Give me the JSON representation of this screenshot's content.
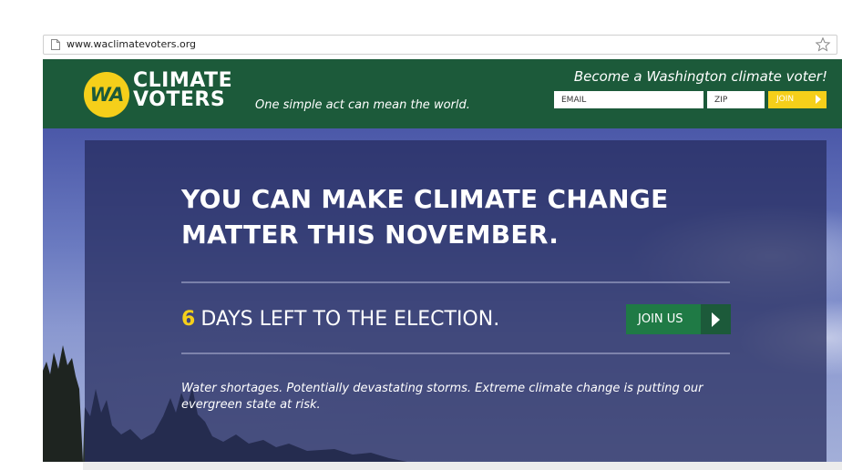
{
  "browser": {
    "url": "www.waclimatevoters.org"
  },
  "header": {
    "logo_abbr": "WA",
    "logo_line1": "CLIMATE",
    "logo_line2": "VOTERS",
    "tagline": "One simple act can mean the world.",
    "signup_title": "Become a Washington climate voter!",
    "email_placeholder": "EMAIL",
    "zip_placeholder": "ZIP",
    "join_label": "JOIN"
  },
  "hero": {
    "headline_line1": "YOU CAN MAKE CLIMATE CHANGE",
    "headline_line2": "MATTER THIS NOVEMBER.",
    "countdown_number": "6",
    "countdown_text": "DAYS LEFT TO THE ELECTION.",
    "join_us_label": "JOIN US",
    "body_text": "Water shortages. Potentially devastating storms. Extreme climate change is putting our evergreen state at risk."
  },
  "colors": {
    "header_green": "#1c5a3a",
    "accent_yellow": "#f5cf1a",
    "button_green": "#1f7a45",
    "overlay_navy": "#242a5c"
  },
  "icons": {
    "page": "page-icon",
    "bookmark": "star-icon",
    "join_arrow": "arrow-right-icon"
  }
}
